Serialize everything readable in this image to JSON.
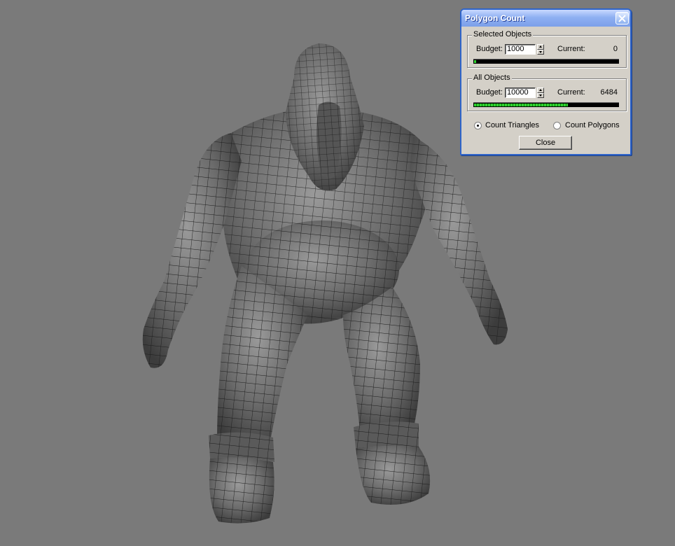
{
  "dialog": {
    "title": "Polygon Count",
    "selected_objects": {
      "legend": "Selected Objects",
      "budget_label": "Budget:",
      "budget_value": "1000",
      "current_label": "Current:",
      "current_value": "0",
      "progress_fraction": 0.01
    },
    "all_objects": {
      "legend": "All Objects",
      "budget_label": "Budget:",
      "budget_value": "10000",
      "current_label": "Current:",
      "current_value": "6484",
      "progress_fraction": 0.6484
    },
    "options": {
      "count_triangles_label": "Count Triangles",
      "count_polygons_label": "Count Polygons",
      "selected": "count_triangles"
    },
    "close_button_label": "Close"
  },
  "colors": {
    "viewport_bg": "#7a7a7a",
    "dialog_bg": "#d4d0c8",
    "title_bar": "#7b9fe9",
    "progress_green": "#2fd22f"
  },
  "icons": {
    "close": "close-x-icon"
  }
}
